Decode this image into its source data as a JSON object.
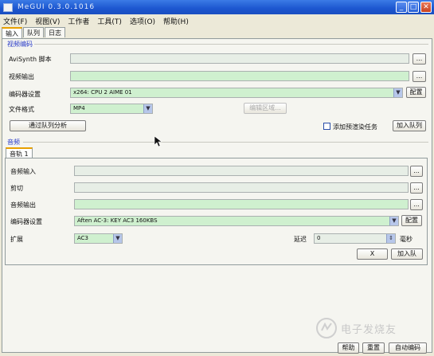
{
  "window": {
    "title": "MeGUI 0.3.0.1016"
  },
  "menu": [
    "文件(F)",
    "视图(V)",
    "工作者",
    "工具(T)",
    "选项(O)",
    "帮助(H)"
  ],
  "tabs": [
    "输入",
    "队列",
    "日志"
  ],
  "video": {
    "section_title": "视频编码",
    "avisynth_label": "AviSynth 脚本",
    "avisynth_value": "",
    "output_label": "视频输出",
    "output_value": "",
    "encoder_label": "编码器设置",
    "encoder_value": "x264: CPU 2 AIME 01",
    "config_button": "配置",
    "format_label": "文件格式",
    "format_value": "MP4",
    "edit_zones_button": "编辑区域...",
    "queue_analysis_button": "通过队列分析",
    "add_prerender_label": "添加预渲染任务",
    "add_queue_button": "加入队列",
    "browse_label": "..."
  },
  "audio": {
    "section_title": "音频",
    "track_tab": "音轨 1",
    "input_label": "音频输入",
    "input_value": "",
    "cut_label": "剪切",
    "cut_value": "",
    "output_label": "音频输出",
    "output_value": "",
    "encoder_label": "编码器设置",
    "encoder_value": "Aften AC-3: KEY AC3 160KBS",
    "config_button": "配置",
    "ext_label": "扩展",
    "ext_value": "AC3",
    "delay_label": "延迟",
    "delay_value": "0",
    "delay_unit": "毫秒",
    "clear_button": "X",
    "add_queue_button": "加入队",
    "browse_label": "..."
  },
  "footer": {
    "help_button": "帮助",
    "reset_button": "重置",
    "auto_encode_button": "自动编码"
  },
  "watermark": {
    "text": "电子发烧友"
  }
}
